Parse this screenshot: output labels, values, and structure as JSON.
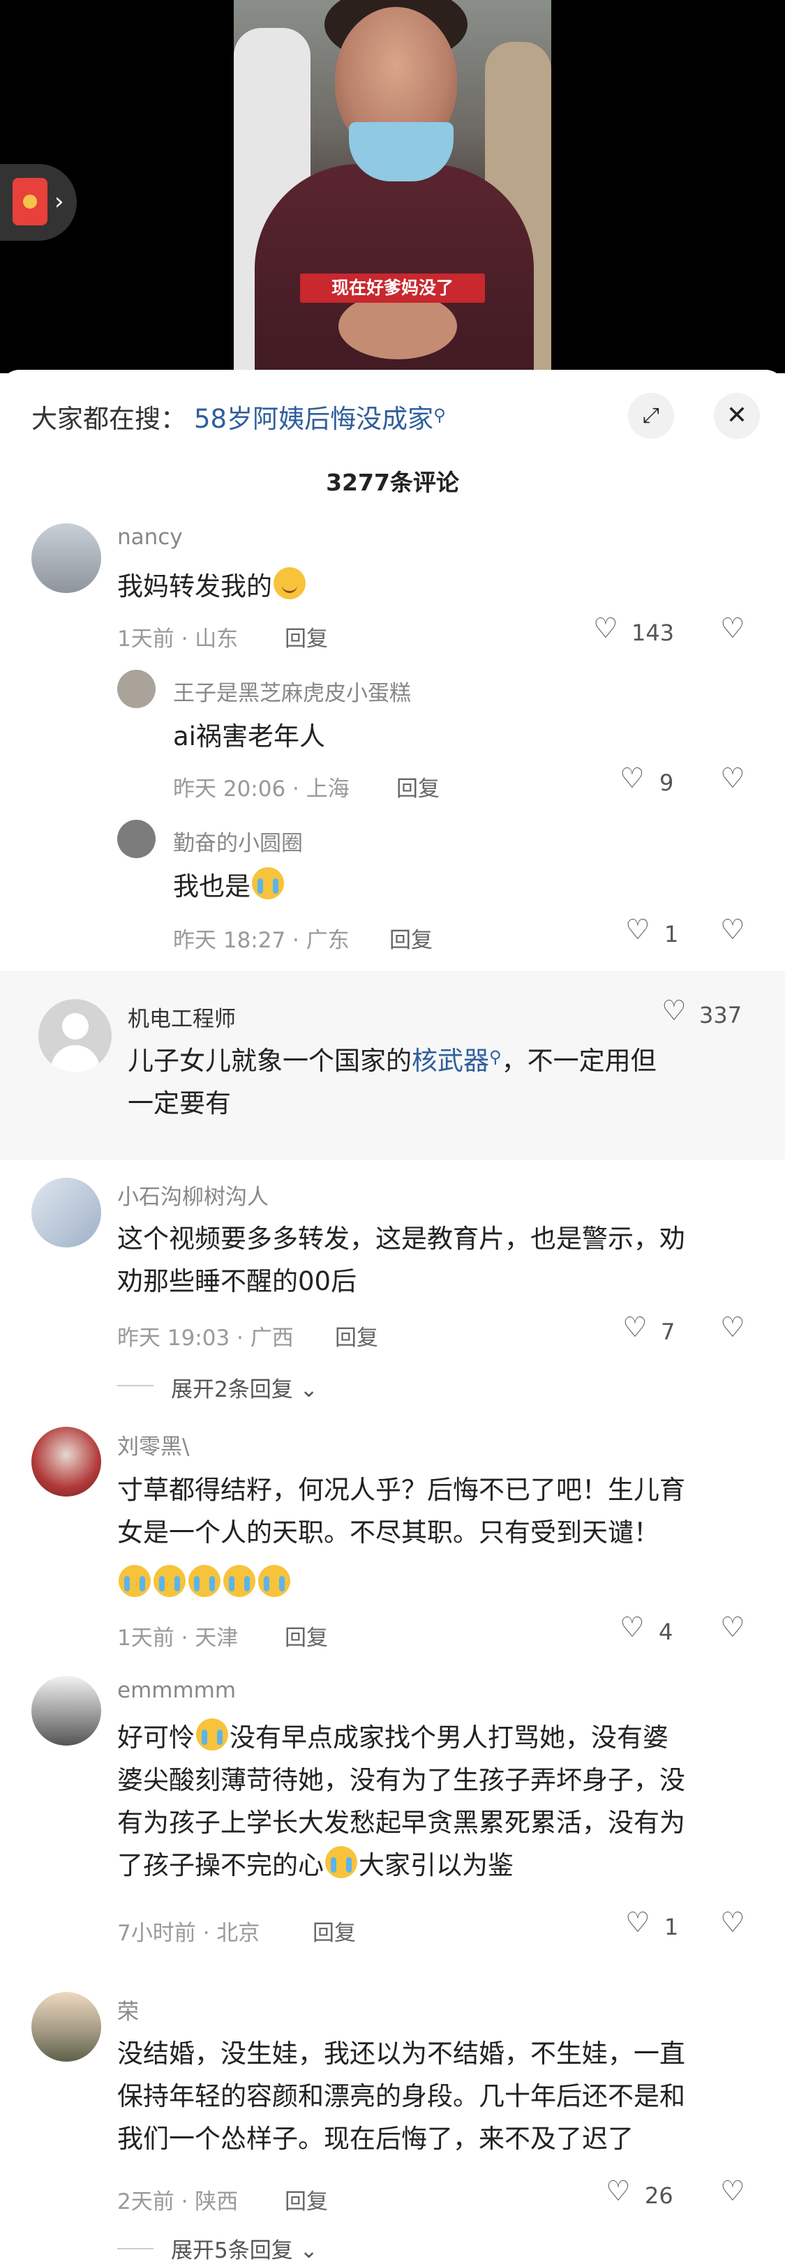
{
  "video": {
    "caption": "现在好爹妈没了"
  },
  "header": {
    "search_prefix": "大家都在搜：",
    "search_term": "58岁阿姨后悔没成家",
    "comment_count": "3277条评论"
  },
  "comments": [
    {
      "name": "nancy",
      "text": "我妈转发我的",
      "meta": "1天前 · 山东",
      "reply": "回复",
      "likes": "143",
      "replies": [
        {
          "name": "王子是黑芝麻虎皮小蛋糕",
          "text": "ai祸害老年人",
          "meta": "昨天 20:06 · 上海",
          "reply": "回复",
          "likes": "9"
        },
        {
          "name": "勤奋的小圆圈",
          "text": "我也是",
          "meta": "昨天 18:27 · 广东",
          "reply": "回复",
          "likes": "1"
        }
      ]
    },
    {
      "name": "机电工程师",
      "text_before": "儿子女儿就象一个国家的",
      "text_link": "核武器",
      "text_after": "，不一定用但",
      "text_line2": "一定要有",
      "likes": "337"
    },
    {
      "name": "小石沟柳树沟人",
      "text_line1": "这个视频要多多转发，这是教育片，也是警示，劝",
      "text_line2": "劝那些睡不醒的00后",
      "meta": "昨天 19:03 · 广西",
      "reply": "回复",
      "likes": "7",
      "expand": "展开2条回复"
    },
    {
      "name": "刘零黑\\",
      "text_line1": "寸草都得结籽，何况人乎？后悔不已了吧！生儿育",
      "text_line2": "女是一个人的天职。不尽其职。只有受到天谴！",
      "meta": "1天前 · 天津",
      "reply": "回复",
      "likes": "4"
    },
    {
      "name": "emmmmm",
      "text_line1a": "好可怜",
      "text_line1b": "没有早点成家找个男人打骂她，没有婆",
      "text_line2": "婆尖酸刻薄苛待她，没有为了生孩子弄坏身子，没",
      "text_line3": "有为孩子上学长大发愁起早贪黑累死累活，没有为",
      "text_line4a": "了孩子操不完的心",
      "text_line4b": "大家引以为鉴",
      "meta": "7小时前 · 北京",
      "reply": "回复",
      "likes": "1"
    },
    {
      "name": "荣",
      "text_line1": "没结婚，没生娃，我还以为不结婚，不生娃，一直",
      "text_line2": "保持年轻的容颜和漂亮的身段。几十年后还不是和",
      "text_line3": "我们一个怂样子。现在后悔了，来不及了迟了",
      "meta": "2天前 · 陕西",
      "reply": "回复",
      "likes": "26",
      "expand": "展开5条回复"
    }
  ],
  "colors": {
    "link": "#2f5f9c",
    "caption_bg": "#c8282e"
  },
  "icons": [
    "gift-icon",
    "expand-icon",
    "close-icon",
    "search-icon",
    "heart-icon",
    "broken-heart-icon",
    "chevron-down-icon",
    "smile-emoji",
    "cry-emoji"
  ]
}
